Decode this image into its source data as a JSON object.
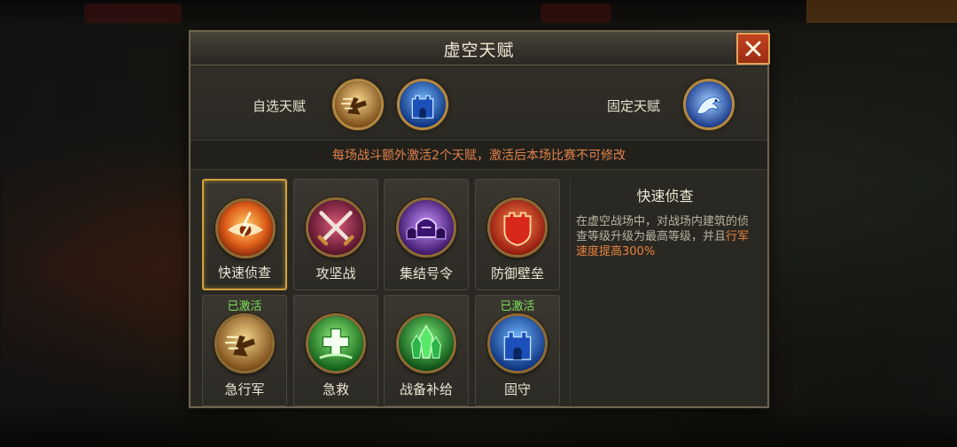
{
  "modal": {
    "title": "虚空天赋",
    "close_glyph": "X"
  },
  "talent_bar": {
    "custom_label": "自选天赋",
    "fixed_label": "固定天赋",
    "custom_slots": [
      "rush-march-icon",
      "fortify-tower-icon"
    ],
    "fixed_slot": "dragon-icon"
  },
  "notice": "每场战斗额外激活2个天赋，激活后本场比赛不可修改",
  "talents": [
    {
      "label": "快速侦查",
      "icon": "eye-icon",
      "selected": true,
      "badge": ""
    },
    {
      "label": "攻坚战",
      "icon": "crossed-swords-icon",
      "selected": false,
      "badge": ""
    },
    {
      "label": "集结号令",
      "icon": "helmet-squad-icon",
      "selected": false,
      "badge": ""
    },
    {
      "label": "防御壁垒",
      "icon": "shield-wall-icon",
      "selected": false,
      "badge": ""
    },
    {
      "label": "急行军",
      "icon": "rush-march-icon",
      "selected": false,
      "badge": "已激活"
    },
    {
      "label": "急救",
      "icon": "medical-cross-icon",
      "selected": false,
      "badge": ""
    },
    {
      "label": "战备补给",
      "icon": "crystal-icon",
      "selected": false,
      "badge": ""
    },
    {
      "label": "固守",
      "icon": "fortify-tower-icon",
      "selected": false,
      "badge": "已激活"
    }
  ],
  "detail": {
    "title": "快速侦查",
    "body_part1": "在虚空战场中，对战场内建筑的侦查等级升级为最高等级，并且",
    "body_highlight": "行军速度提高300%"
  },
  "colors": {
    "accent_gold": "#d3a338",
    "active_green": "#7de05a",
    "notice_orange": "#e0824a",
    "close_red": "#c4421f"
  }
}
